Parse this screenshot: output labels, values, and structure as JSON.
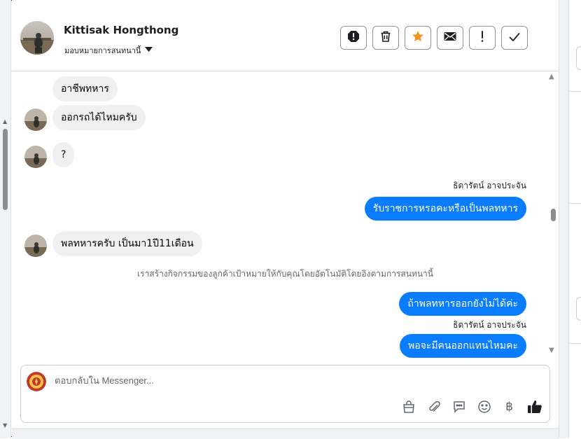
{
  "header": {
    "contact_name": "Kittisak Hongthong",
    "assign_label": "มอบหมายการสนทนานี้",
    "toolbar": [
      {
        "name": "spam-button",
        "icon": "exclamation-octagon-icon"
      },
      {
        "name": "delete-button",
        "icon": "trash-icon"
      },
      {
        "name": "star-button",
        "icon": "star-icon",
        "color": "#f7931e"
      },
      {
        "name": "mark-unread-button",
        "icon": "envelope-icon"
      },
      {
        "name": "follow-up-button",
        "icon": "exclamation-icon"
      },
      {
        "name": "mark-done-button",
        "icon": "check-icon"
      }
    ]
  },
  "messages": {
    "in_1": "อาชีพทหาร",
    "in_2": "ออกรถได้ไหมครับ",
    "in_3": "?",
    "sender_1": "ธิดารัตน์ อาจประจัน",
    "out_1": "รับราชการหรอคะหรือเป็นพลทหาร",
    "in_4": "พลทหารครับ เป็นมา1ปี11เดือน",
    "system_note": "เราสร้างกิจกรรมของลูกค้าเป้าหมายให้กับคุณโดยอัตโนมัติโดยอิงตามการสนทนานี้",
    "out_2": "ถ้าพลทหารออกยังไม่ได้ค่ะ",
    "sender_2": "ธิดารัตน์ อาจประจัน",
    "out_3": "พอจะมีคนออกแทนไหมคะ"
  },
  "composer": {
    "placeholder": "ตอบกลับใน Messenger...",
    "tools": [
      "shopping-bag-icon",
      "paperclip-icon",
      "saved-reply-icon",
      "emoji-icon",
      "baht-icon",
      "thumbs-up-icon"
    ],
    "baht_symbol": "฿"
  },
  "colors": {
    "outgoing_bubble": "#0a7cff",
    "incoming_bubble": "#f0f0f0",
    "star": "#f7931e"
  }
}
